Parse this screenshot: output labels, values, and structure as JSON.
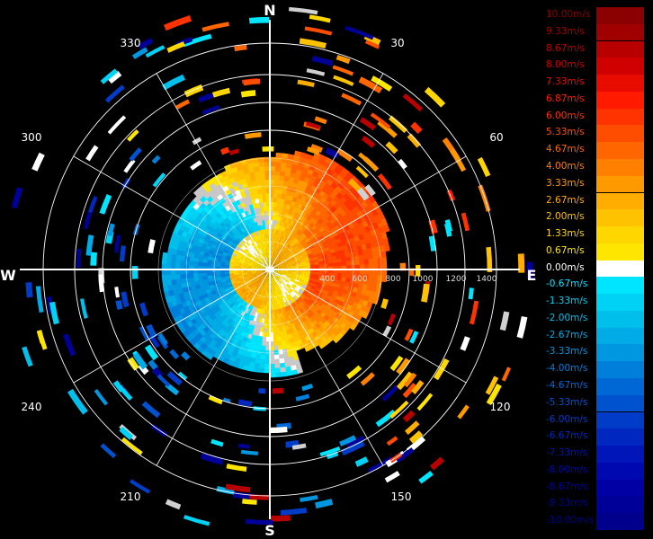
{
  "chart_data": {
    "type": "heatmap",
    "subtype": "polar-ppi-radial-velocity",
    "cardinals": [
      "N",
      "E",
      "S",
      "W"
    ],
    "azimuth_labels": [
      "30",
      "60",
      "120",
      "150",
      "210",
      "240",
      "300",
      "330"
    ],
    "range_labels": [
      "400",
      "600",
      "800",
      "1000",
      "1200",
      "1400"
    ],
    "range_max": 1400,
    "grid": true,
    "legend_position": "right",
    "colorbar": [
      {
        "label": "10.00m/s",
        "color": "#8b0000"
      },
      {
        "label": "9.33m/s",
        "color": "#a00000"
      },
      {
        "label": "8.67m/s",
        "color": "#b80000"
      },
      {
        "label": "8.00m/s",
        "color": "#d00000"
      },
      {
        "label": "7.33m/s",
        "color": "#e80c00"
      },
      {
        "label": "6.87m/s",
        "color": "#ff1a00"
      },
      {
        "label": "6.00m/s",
        "color": "#ff3300"
      },
      {
        "label": "5.33m/s",
        "color": "#ff4d00"
      },
      {
        "label": "4.67m/s",
        "color": "#ff6600"
      },
      {
        "label": "4.00m/s",
        "color": "#ff8000"
      },
      {
        "label": "3.33m/s",
        "color": "#ff9900"
      },
      {
        "label": "2.67m/s",
        "color": "#ffad00"
      },
      {
        "label": "2.00m/s",
        "color": "#ffc200"
      },
      {
        "label": "1.33m/s",
        "color": "#ffd600"
      },
      {
        "label": "0.67m/s",
        "color": "#ffe600"
      },
      {
        "label": "0.00m/s",
        "color": "#ffffff"
      },
      {
        "label": "-0.67m/s",
        "color": "#00e5ff"
      },
      {
        "label": "-1.33m/s",
        "color": "#00d2f5"
      },
      {
        "label": "-2.00m/s",
        "color": "#00bfeb"
      },
      {
        "label": "-2.67m/s",
        "color": "#00abe6"
      },
      {
        "label": "-3.33m/s",
        "color": "#0096e0"
      },
      {
        "label": "-4.00m/s",
        "color": "#007fda"
      },
      {
        "label": "-4.67m/s",
        "color": "#0068d4"
      },
      {
        "label": "-5.33m/s",
        "color": "#0052ce"
      },
      {
        "label": "-6.00m/s",
        "color": "#003cc8"
      },
      {
        "label": "-6.67m/s",
        "color": "#0028c0"
      },
      {
        "label": "-7.33m/s",
        "color": "#0016b8"
      },
      {
        "label": "-8.00m/s",
        "color": "#0008b0"
      },
      {
        "label": "-8.67m/s",
        "color": "#0000a4"
      },
      {
        "label": "-9.33m/s",
        "color": "#000098"
      },
      {
        "label": "-10.00m/s",
        "color": "#00008c"
      }
    ]
  }
}
